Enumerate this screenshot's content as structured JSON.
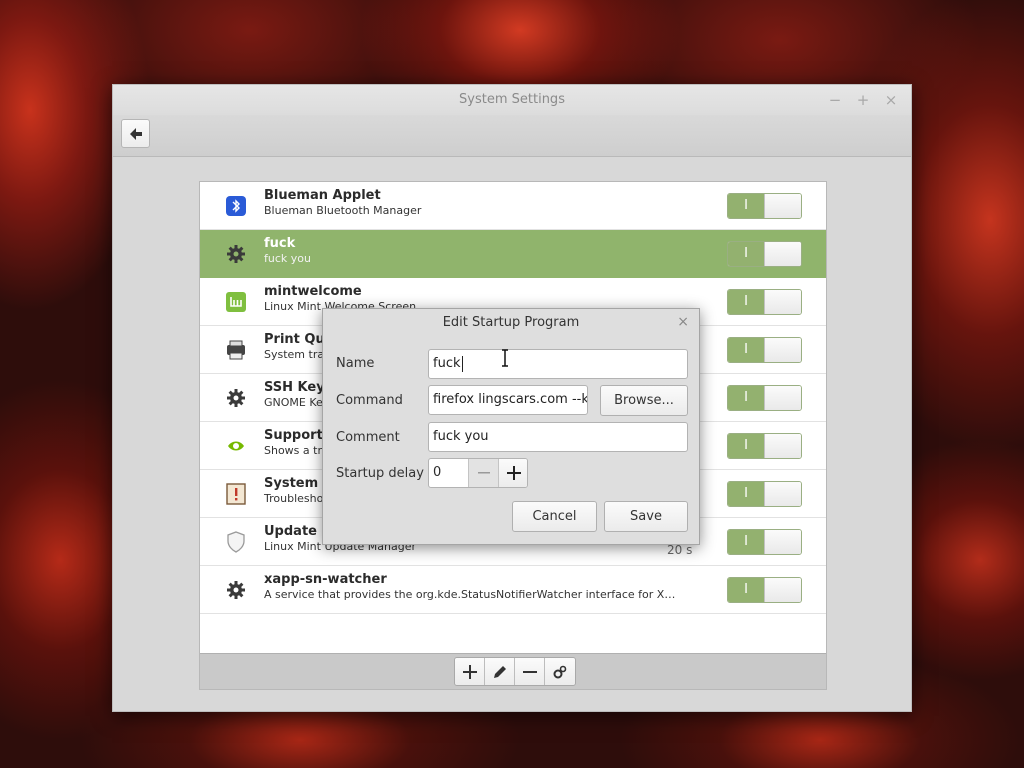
{
  "window": {
    "title": "System Settings",
    "controls": {
      "minimize": "−",
      "maximize": "+",
      "close": "×"
    }
  },
  "startup_items": [
    {
      "name": "Blueman Applet",
      "description": "Blueman Bluetooth Manager",
      "icon": "bluetooth-icon",
      "enabled": true,
      "delay": ""
    },
    {
      "name": "fuck",
      "description": "fuck you",
      "icon": "gear-icon",
      "enabled": true,
      "delay": "",
      "selected": true
    },
    {
      "name": "mintwelcome",
      "description": "Linux Mint Welcome Screen",
      "icon": "mint-logo-icon",
      "enabled": true,
      "delay": ""
    },
    {
      "name": "Print Que",
      "description": "System tray",
      "icon": "printer-icon",
      "enabled": true,
      "delay": ""
    },
    {
      "name": "SSH Key A",
      "description": "GNOME Key",
      "icon": "gear-icon",
      "enabled": true,
      "delay": ""
    },
    {
      "name": "Support f",
      "description": "Shows a tray",
      "icon": "nvidia-icon",
      "enabled": true,
      "delay": ""
    },
    {
      "name": "System Re",
      "description": "Troubleshoo",
      "icon": "system-report-icon",
      "enabled": true,
      "delay": ""
    },
    {
      "name": "Update M",
      "description": "Linux Mint Update Manager",
      "icon": "shield-icon",
      "enabled": true,
      "delay": "20 s"
    },
    {
      "name": "xapp-sn-watcher",
      "description": "A service that provides the org.kde.StatusNotifierWatcher interface for X…",
      "icon": "gear-icon",
      "enabled": true,
      "delay": ""
    }
  ],
  "switch_on_label": "I",
  "dialog": {
    "title": "Edit Startup Program",
    "close": "×",
    "name_label": "Name",
    "name_value": "fuck",
    "command_label": "Command",
    "command_value": "firefox lingscars.com --kio",
    "browse_label": "Browse...",
    "comment_label": "Comment",
    "comment_value": "fuck you",
    "delay_label": "Startup delay",
    "delay_value": "0",
    "cancel_label": "Cancel",
    "save_label": "Save"
  },
  "colors": {
    "accent": "#90b46c",
    "window_bg": "#d8d8d8"
  }
}
